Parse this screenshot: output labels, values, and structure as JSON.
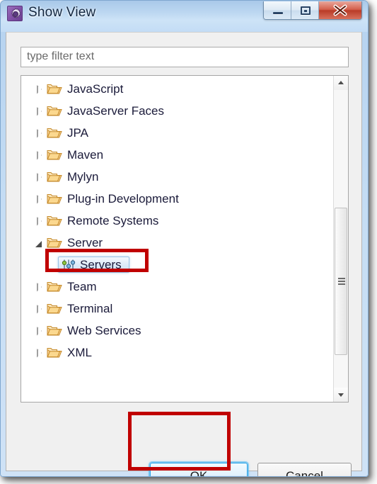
{
  "window": {
    "title": "Show View",
    "icon": "show-view-gear-icon",
    "controls": {
      "minimize": "Minimize",
      "maximize": "Maximize",
      "close": "Close"
    }
  },
  "filter": {
    "placeholder": "type filter text",
    "value": "type filter text"
  },
  "tree": {
    "items": [
      {
        "label": "JavaScript",
        "icon": "folder-icon",
        "expanded": false,
        "child": false,
        "selected": false
      },
      {
        "label": "JavaServer Faces",
        "icon": "folder-icon",
        "expanded": false,
        "child": false,
        "selected": false
      },
      {
        "label": "JPA",
        "icon": "folder-icon",
        "expanded": false,
        "child": false,
        "selected": false
      },
      {
        "label": "Maven",
        "icon": "folder-icon",
        "expanded": false,
        "child": false,
        "selected": false
      },
      {
        "label": "Mylyn",
        "icon": "folder-icon",
        "expanded": false,
        "child": false,
        "selected": false
      },
      {
        "label": "Plug-in Development",
        "icon": "folder-icon",
        "expanded": false,
        "child": false,
        "selected": false
      },
      {
        "label": "Remote Systems",
        "icon": "folder-icon",
        "expanded": false,
        "child": false,
        "selected": false
      },
      {
        "label": "Server",
        "icon": "folder-icon",
        "expanded": true,
        "child": false,
        "selected": false
      },
      {
        "label": "Servers",
        "icon": "servers-view-icon",
        "expanded": null,
        "child": true,
        "selected": true
      },
      {
        "label": "Team",
        "icon": "folder-icon",
        "expanded": false,
        "child": false,
        "selected": false
      },
      {
        "label": "Terminal",
        "icon": "folder-icon",
        "expanded": false,
        "child": false,
        "selected": false
      },
      {
        "label": "Web Services",
        "icon": "folder-icon",
        "expanded": false,
        "child": false,
        "selected": false
      },
      {
        "label": "XML",
        "icon": "folder-icon",
        "expanded": false,
        "child": false,
        "selected": false
      }
    ]
  },
  "buttons": {
    "ok": "OK",
    "cancel": "Cancel"
  },
  "annotations": {
    "servers_highlight": "red-rectangle-around-servers",
    "ok_highlight": "red-rectangle-around-ok-button"
  },
  "colors": {
    "annotation_red": "#c00000",
    "selection_blue": "#cfe3f6",
    "title_blue": "#bcd7f1",
    "folder_gold": "#f5c96a"
  }
}
